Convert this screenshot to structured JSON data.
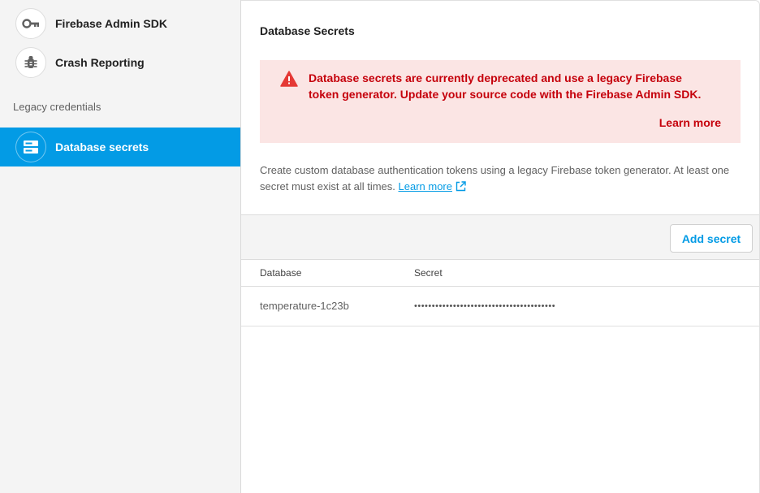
{
  "sidebar": {
    "items": [
      {
        "label": "Firebase Admin SDK",
        "icon": "key-icon"
      },
      {
        "label": "Crash Reporting",
        "icon": "bug-icon"
      }
    ],
    "section_label": "Legacy credentials",
    "active_item": {
      "label": "Database secrets",
      "icon": "database-icon"
    }
  },
  "main": {
    "title": "Database Secrets",
    "alert": {
      "message": "Database secrets are currently deprecated and use a legacy Firebase token generator. Update your source code with the Firebase Admin SDK.",
      "learn_more": "Learn more",
      "icon": "warning-icon"
    },
    "description": "Create custom database authentication tokens using a legacy Firebase token generator. At least one secret must exist at all times.",
    "description_link": "Learn more",
    "add_secret_label": "Add secret",
    "table": {
      "columns": [
        "Database",
        "Secret"
      ],
      "rows": [
        {
          "database": "temperature-1c23b",
          "secret": "••••••••••••••••••••••••••••••••••••••••"
        }
      ]
    }
  },
  "colors": {
    "accent": "#039be5",
    "alert_text": "#c5000b",
    "alert_bg": "#fbe5e4",
    "warning_icon": "#e53935"
  }
}
